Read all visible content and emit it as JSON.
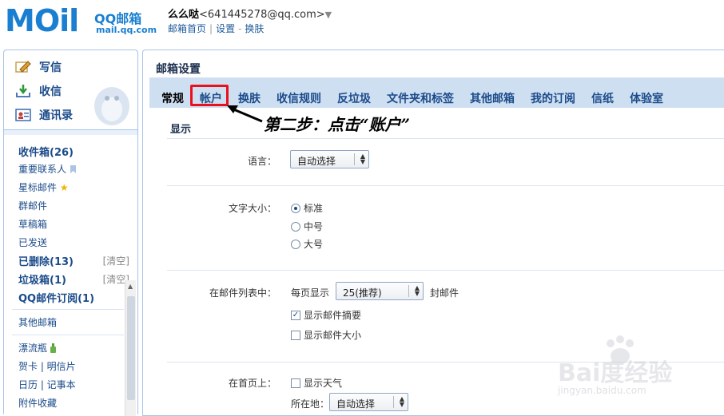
{
  "header": {
    "logo_text": "MOil",
    "logo_brand": "QQ邮箱",
    "logo_domain": "mail.qq.com",
    "user_name": "么么哒",
    "user_email": "<641445278@qq.com>",
    "links": [
      "邮箱首页",
      "设置",
      "换肤"
    ]
  },
  "sidebar": {
    "compose": [
      {
        "label": "写信",
        "icon": "pencil-icon"
      },
      {
        "label": "收信",
        "icon": "inbox-download-icon"
      },
      {
        "label": "通讯录",
        "icon": "contacts-card-icon"
      }
    ],
    "folders": [
      {
        "label": "收件箱(26)",
        "bold": true
      },
      {
        "label": "重要联系人",
        "icon": "bookmark-icon"
      },
      {
        "label": "星标邮件",
        "icon": "star-icon"
      },
      {
        "label": "群邮件"
      },
      {
        "label": "草稿箱"
      },
      {
        "label": "已发送"
      },
      {
        "label": "已删除(13)",
        "bold": true,
        "action": "[清空]"
      },
      {
        "label": "垃圾箱(1)",
        "bold": true,
        "action": "[清空]"
      },
      {
        "label": "QQ邮件订阅(1)",
        "bold": true
      }
    ],
    "other_mailbox": "其他邮箱",
    "apps": [
      {
        "label": "漂流瓶",
        "icon": "bottle-icon"
      },
      {
        "label": "贺卡 | 明信片"
      },
      {
        "label": "日历 | 记事本"
      },
      {
        "label": "附件收藏"
      }
    ]
  },
  "main": {
    "title": "邮箱设置",
    "tabs": [
      "常规",
      "帐户",
      "换肤",
      "收信规则",
      "反垃圾",
      "文件夹和标签",
      "其他邮箱",
      "我的订阅",
      "信纸",
      "体验室"
    ],
    "active_tab": "常规",
    "highlighted_tab": "帐户",
    "annotation": "第二步：点击“账户”",
    "section": "显示",
    "language": {
      "label": "语言：",
      "value": "自动选择"
    },
    "font_size": {
      "label": "文字大小：",
      "options": [
        "标准",
        "中号",
        "大号"
      ],
      "selected": "标准"
    },
    "list": {
      "label": "在邮件列表中：",
      "prefix": "每页显示",
      "value": "25(推荐)",
      "suffix": "封邮件",
      "checks": [
        {
          "label": "显示邮件摘要",
          "checked": true
        },
        {
          "label": "显示邮件大小",
          "checked": false
        }
      ]
    },
    "homepage": {
      "label": "在首页上：",
      "check_label": "显示天气",
      "location_label": "所在地：",
      "location_value": "自动选择"
    }
  },
  "watermark": {
    "brand": "Bai度经验",
    "url": "jingyan.baidu.com"
  },
  "colors": {
    "accent": "#1a7fd1",
    "tab_bar": "#cfdff2",
    "highlight": "#e8111c"
  }
}
